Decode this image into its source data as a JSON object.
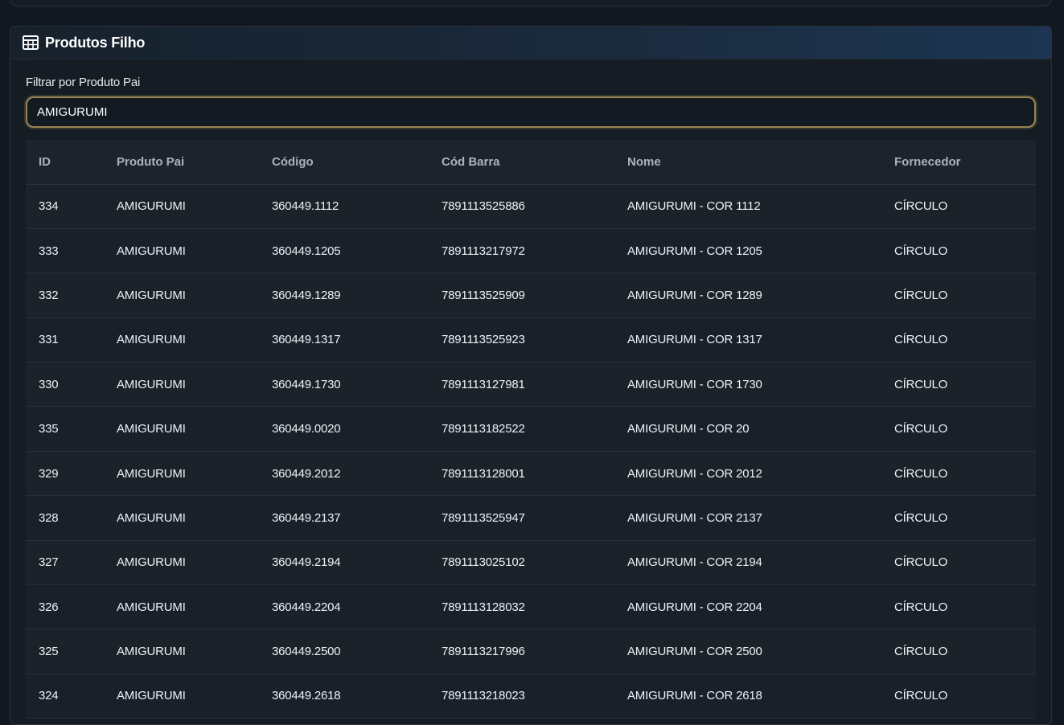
{
  "panel": {
    "title": "Produtos Filho",
    "icon": "table-icon"
  },
  "filter": {
    "label": "Filtrar por Produto Pai",
    "value": "AMIGURUMI"
  },
  "table": {
    "columns": [
      "ID",
      "Produto Pai",
      "Código",
      "Cód Barra",
      "Nome",
      "Fornecedor"
    ],
    "rows": [
      [
        "334",
        "AMIGURUMI",
        "360449.1112",
        "7891113525886",
        "AMIGURUMI - COR 1112",
        "CÍRCULO"
      ],
      [
        "333",
        "AMIGURUMI",
        "360449.1205",
        "7891113217972",
        "AMIGURUMI - COR 1205",
        "CÍRCULO"
      ],
      [
        "332",
        "AMIGURUMI",
        "360449.1289",
        "7891113525909",
        "AMIGURUMI - COR 1289",
        "CÍRCULO"
      ],
      [
        "331",
        "AMIGURUMI",
        "360449.1317",
        "7891113525923",
        "AMIGURUMI - COR 1317",
        "CÍRCULO"
      ],
      [
        "330",
        "AMIGURUMI",
        "360449.1730",
        "7891113127981",
        "AMIGURUMI - COR 1730",
        "CÍRCULO"
      ],
      [
        "335",
        "AMIGURUMI",
        "360449.0020",
        "7891113182522",
        "AMIGURUMI - COR 20",
        "CÍRCULO"
      ],
      [
        "329",
        "AMIGURUMI",
        "360449.2012",
        "7891113128001",
        "AMIGURUMI - COR 2012",
        "CÍRCULO"
      ],
      [
        "328",
        "AMIGURUMI",
        "360449.2137",
        "7891113525947",
        "AMIGURUMI - COR 2137",
        "CÍRCULO"
      ],
      [
        "327",
        "AMIGURUMI",
        "360449.2194",
        "7891113025102",
        "AMIGURUMI - COR 2194",
        "CÍRCULO"
      ],
      [
        "326",
        "AMIGURUMI",
        "360449.2204",
        "7891113128032",
        "AMIGURUMI - COR 2204",
        "CÍRCULO"
      ],
      [
        "325",
        "AMIGURUMI",
        "360449.2500",
        "7891113217996",
        "AMIGURUMI - COR 2500",
        "CÍRCULO"
      ],
      [
        "324",
        "AMIGURUMI",
        "360449.2618",
        "7891113218023",
        "AMIGURUMI - COR 2618",
        "CÍRCULO"
      ]
    ]
  }
}
